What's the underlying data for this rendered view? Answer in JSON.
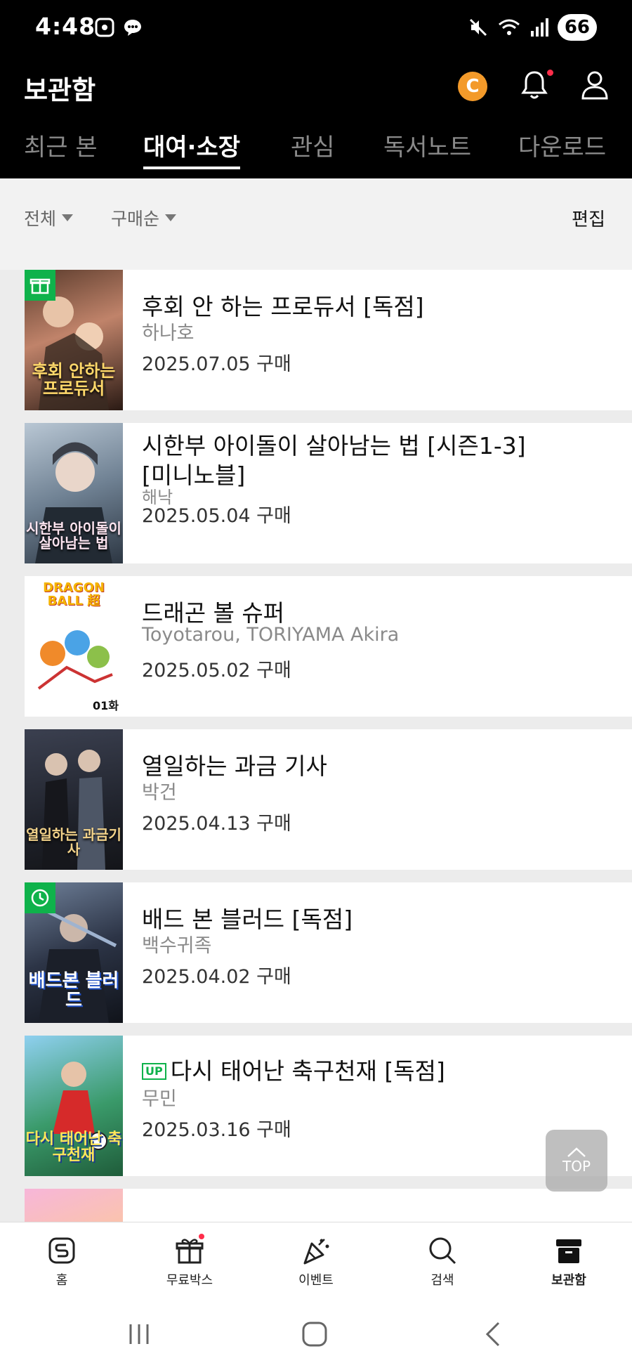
{
  "status_bar": {
    "time": "4:48",
    "battery": "66"
  },
  "app_bar": {
    "title": "보관함",
    "coin_symbol": "C"
  },
  "tabs": [
    {
      "label": "최근 본"
    },
    {
      "label": "대여·소장"
    },
    {
      "label": "관심"
    },
    {
      "label": "독서노트"
    },
    {
      "label": "다운로드"
    }
  ],
  "active_tab": "대여·소장",
  "filters": {
    "category": "전체",
    "sort": "구매순",
    "edit_label": "편집"
  },
  "items": [
    {
      "title": "후회 안 하는 프로듀서 [독점]",
      "author": "하나호",
      "date": "2025.07.05 구매",
      "cover_text": "후회 안하는 프로듀서",
      "badge": "gift-icon"
    },
    {
      "title_line1": "시한부 아이돌이 살아남는 법 [시즌1-3]",
      "title_line2": "[미니노블]",
      "author": "해낙",
      "date": "2025.05.04 구매",
      "cover_text": "시한부 아이돌이 살아남는 법"
    },
    {
      "title": "드래곤 볼 슈퍼",
      "author": "Toyotarou, TORIYAMA Akira",
      "date": "2025.05.02 구매",
      "cover_text": "DRAGON BALL 超",
      "cover_issue": "01화"
    },
    {
      "title": "열일하는 과금 기사",
      "author": "박건",
      "date": "2025.04.13 구매",
      "cover_text": "열일하는 과금기사"
    },
    {
      "title": "배드 본 블러드 [독점]",
      "author": "백수귀족",
      "date": "2025.04.02 구매",
      "cover_text": "배드본 블러드",
      "badge": "clock-icon"
    },
    {
      "badge_up": "UP",
      "title": "다시 태어난 축구천재 [독점]",
      "author": "무민",
      "date": "2025.03.16 구매",
      "cover_text": "다시 태어난 축구천재"
    }
  ],
  "top_button": "TOP",
  "bottom_nav": [
    {
      "label": "홈"
    },
    {
      "label": "무료박스"
    },
    {
      "label": "이벤트"
    },
    {
      "label": "검색"
    },
    {
      "label": "보관함"
    }
  ],
  "colors": {
    "accent_green": "#0fb24b",
    "coin_orange": "#f39a2a",
    "notify_red": "#ff2d4a"
  }
}
